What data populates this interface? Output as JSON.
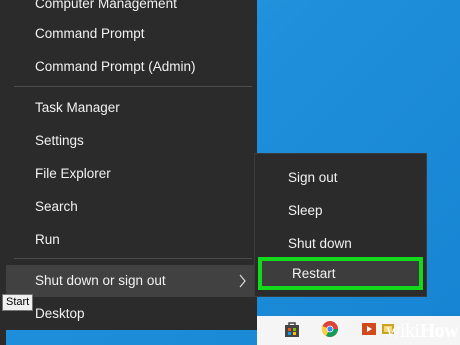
{
  "menu": {
    "items": [
      {
        "label": "Computer Management"
      },
      {
        "label": "Command Prompt"
      },
      {
        "label": "Command Prompt (Admin)"
      },
      {
        "label": "Task Manager"
      },
      {
        "label": "Settings"
      },
      {
        "label": "File Explorer"
      },
      {
        "label": "Search"
      },
      {
        "label": "Run"
      },
      {
        "label": "Shut down or sign out",
        "submenu_arrow": "chevron-right-icon"
      },
      {
        "label": "Desktop"
      }
    ]
  },
  "submenu": {
    "items": [
      {
        "label": "Sign out"
      },
      {
        "label": "Sleep"
      },
      {
        "label": "Shut down"
      },
      {
        "label": "Restart",
        "highlighted": true
      }
    ],
    "highlight_color": "#13d91b"
  },
  "tooltip": {
    "text": "Start"
  },
  "taskbar": {
    "icons": [
      "store-icon",
      "chrome-icon",
      "media-player-icon",
      "app-icon"
    ]
  },
  "watermark": {
    "wiki": "wiki",
    "how": "How"
  }
}
